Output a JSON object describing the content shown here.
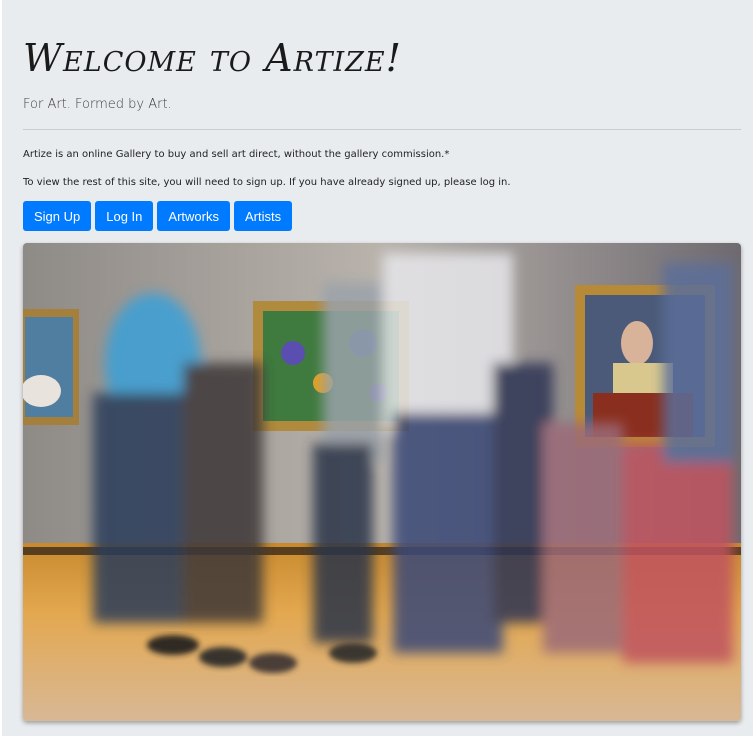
{
  "jumbotron": {
    "title": "Welcome to Artize!",
    "tagline": "For Art. Formed by Art.",
    "description": "Artize is an online Gallery to buy and sell art direct, without the gallery commission.*",
    "signup_prompt": "To view the rest of this site, you will need to sign up. If you have already signed up, please log in."
  },
  "buttons": {
    "signup": "Sign Up",
    "login": "Log In",
    "artworks": "Artworks",
    "artists": "Artists"
  },
  "colors": {
    "primary": "#007bff",
    "background": "#e9ecef"
  }
}
